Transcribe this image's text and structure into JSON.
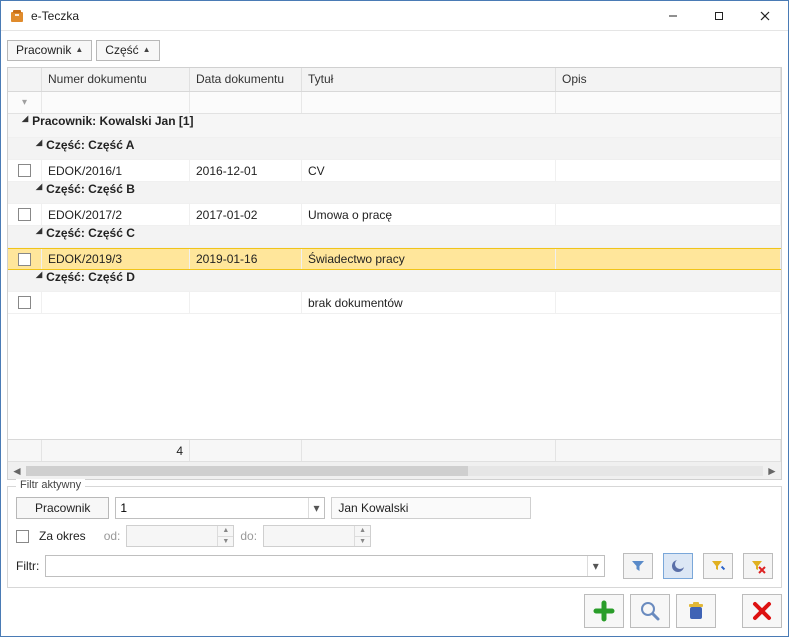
{
  "window": {
    "title": "e-Teczka"
  },
  "group_chips": [
    {
      "label": "Pracownik"
    },
    {
      "label": "Część"
    }
  ],
  "columns": {
    "numer": "Numer dokumentu",
    "data": "Data dokumentu",
    "tytul": "Tytuł",
    "opis": "Opis"
  },
  "groups": {
    "employee_label": "Pracownik: Kowalski Jan [1]",
    "parts": [
      {
        "label": "Część: Część A",
        "rows": [
          {
            "numer": "EDOK/2016/1",
            "data": "2016-12-01",
            "tytul": "CV",
            "opis": ""
          }
        ]
      },
      {
        "label": "Część: Część B",
        "rows": [
          {
            "numer": "EDOK/2017/2",
            "data": "2017-01-02",
            "tytul": "Umowa o pracę",
            "opis": ""
          }
        ]
      },
      {
        "label": "Część: Część C",
        "rows": [
          {
            "numer": "EDOK/2019/3",
            "data": "2019-01-16",
            "tytul": "Świadectwo pracy",
            "opis": "",
            "selected": true
          }
        ]
      },
      {
        "label": "Część: Część D",
        "rows": [
          {
            "numer": "",
            "data": "",
            "tytul": "brak dokumentów",
            "opis": ""
          }
        ]
      }
    ]
  },
  "footer": {
    "count": "4"
  },
  "filter": {
    "legend": "Filtr aktywny",
    "employee_btn": "Pracownik",
    "employee_value": "1",
    "employee_name": "Jan Kowalski",
    "period_label": "Za okres",
    "from_label": "od:",
    "to_label": "do:",
    "filter_label": "Filtr:",
    "filter_value": ""
  }
}
